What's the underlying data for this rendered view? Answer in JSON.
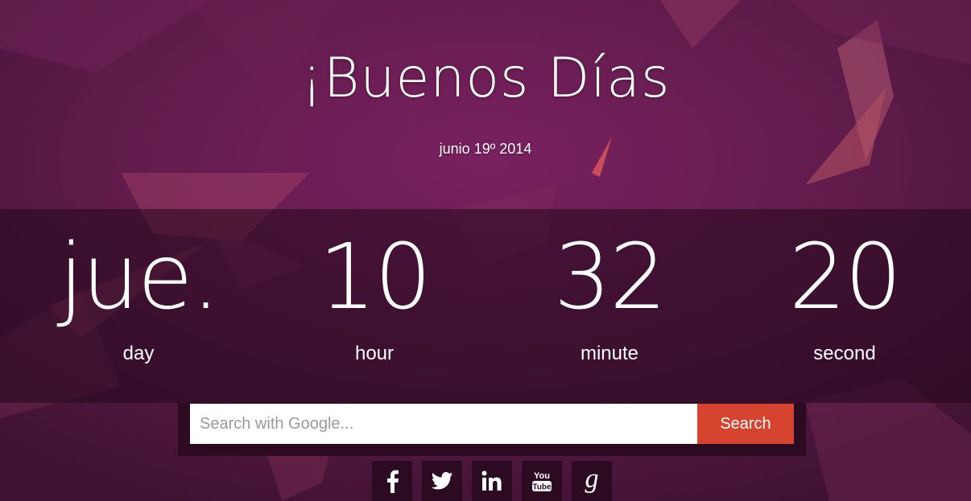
{
  "greeting": "¡Buenos Días",
  "date": "junio 19º 2014",
  "clock": [
    {
      "value": "jue.",
      "label": "day"
    },
    {
      "value": "10",
      "label": "hour"
    },
    {
      "value": "32",
      "label": "minute"
    },
    {
      "value": "20",
      "label": "second"
    }
  ],
  "search": {
    "placeholder": "Search with Google...",
    "value": "",
    "button_label": "Search"
  },
  "social": [
    {
      "icon": "facebook-icon"
    },
    {
      "icon": "twitter-icon"
    },
    {
      "icon": "linkedin-icon"
    },
    {
      "icon": "youtube-icon",
      "glyph": "You Tube"
    },
    {
      "icon": "google-plus-icon",
      "glyph": "g"
    }
  ],
  "colors": {
    "background": "#5a1b44",
    "band": "#23081c",
    "accent": "#d6432f",
    "tile": "#2c0b22"
  }
}
